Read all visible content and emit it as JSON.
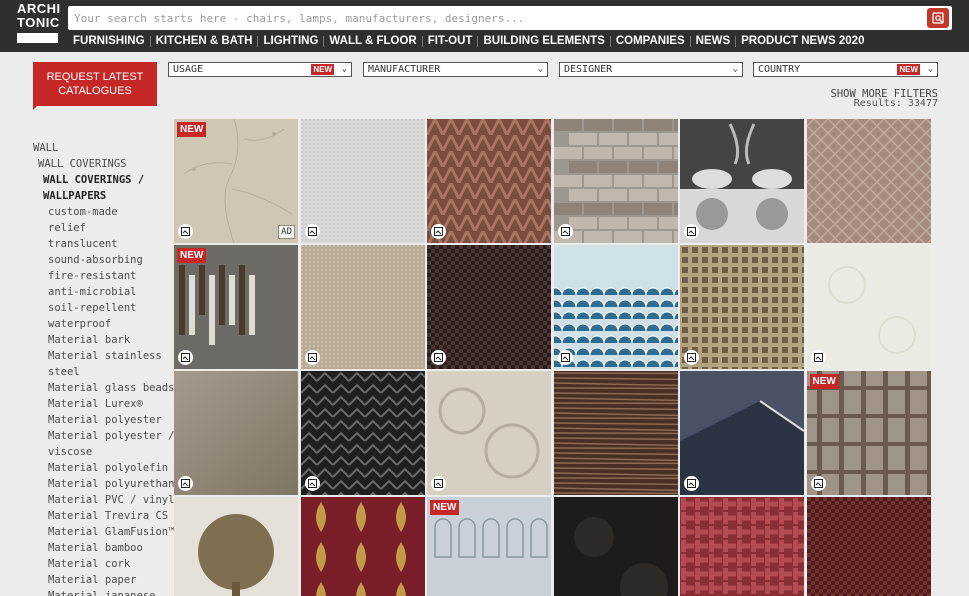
{
  "logo": {
    "line1": "ARCHI",
    "line2": "TONIC"
  },
  "search": {
    "placeholder": "Your search starts here - chairs, lamps, manufacturers, designers..."
  },
  "nav": [
    "FURNISHING",
    "KITCHEN & BATH",
    "LIGHTING",
    "WALL & FLOOR",
    "FIT-OUT",
    "BUILDING ELEMENTS",
    "COMPANIES",
    "NEWS",
    "PRODUCT NEWS 2020"
  ],
  "cta": {
    "line1": "REQUEST LATEST",
    "line2": "CATALOGUES"
  },
  "filters": [
    {
      "label": "USAGE",
      "new": "NEW"
    },
    {
      "label": "MANUFACTURER",
      "new": ""
    },
    {
      "label": "DESIGNER",
      "new": ""
    },
    {
      "label": "COUNTRY",
      "new": "NEW"
    }
  ],
  "more_filters": "SHOW MORE FILTERS",
  "results": "Results: 33477",
  "sidebar": {
    "l0": "WALL",
    "l1": "WALL COVERINGS",
    "l2a": "WALL COVERINGS /",
    "l2b": "WALLPAPERS",
    "items": [
      "custom-made",
      "relief",
      "translucent",
      "sound-absorbing",
      "fire-resistant",
      "anti-microbial",
      "soil-repellent",
      "waterproof",
      "Material bark",
      "Material stainless",
      "steel",
      "Material glass beads",
      "Material Lurex®",
      "Material polyester",
      "Material polyester /",
      "viscose",
      "Material polyolefin",
      "Material polyurethane",
      "Material PVC / vinyl",
      "Material Trevira CS",
      "Material GlamFusion™",
      "Material bamboo",
      "Material cork",
      "Material paper",
      "Material japanese"
    ]
  },
  "tiles": [
    {
      "new": "NEW",
      "ad": "AD",
      "save": true,
      "colors": [
        "#b8ad9c",
        "#cfc6b6"
      ],
      "pattern": "branch"
    },
    {
      "new": "",
      "ad": "",
      "save": true,
      "colors": [
        "#d9d9d9",
        "#c9c9c9"
      ],
      "pattern": "linen"
    },
    {
      "new": "",
      "ad": "",
      "save": true,
      "colors": [
        "#7a4e3e",
        "#a87463"
      ],
      "pattern": "herringbone"
    },
    {
      "new": "",
      "ad": "",
      "save": true,
      "colors": [
        "#9c9890",
        "#c9c1b4"
      ],
      "pattern": "planks"
    },
    {
      "new": "",
      "ad": "",
      "save": true,
      "colors": [
        "#2b2b2b",
        "#d8d8d8"
      ],
      "pattern": "figures"
    },
    {
      "new": "",
      "ad": "",
      "save": false,
      "colors": [
        "#a48a7f",
        "#c2aca1"
      ],
      "pattern": "diamond"
    },
    {
      "new": "NEW",
      "ad": "",
      "save": true,
      "colors": [
        "#6e6b66",
        "#9a958c"
      ],
      "pattern": "stripes"
    },
    {
      "new": "",
      "ad": "",
      "save": true,
      "colors": [
        "#b6aa97",
        "#cfc3b0"
      ],
      "pattern": "linen"
    },
    {
      "new": "",
      "ad": "",
      "save": true,
      "colors": [
        "#2a1f1c",
        "#4a3733"
      ],
      "pattern": "weave"
    },
    {
      "new": "",
      "ad": "",
      "save": true,
      "colors": [
        "#2f6b8f",
        "#cfe0e6"
      ],
      "pattern": "waves"
    },
    {
      "new": "",
      "ad": "",
      "save": true,
      "colors": [
        "#6d5e45",
        "#b3a47f"
      ],
      "pattern": "grid"
    },
    {
      "new": "",
      "ad": "",
      "save": true,
      "colors": [
        "#ecebe3",
        "#e0ddd0"
      ],
      "pattern": "damask"
    },
    {
      "new": "",
      "ad": "",
      "save": true,
      "colors": [
        "#7d7566",
        "#a69a8e"
      ],
      "pattern": "mist"
    },
    {
      "new": "",
      "ad": "",
      "save": true,
      "colors": [
        "#1f1f20",
        "#6a6a6c"
      ],
      "pattern": "chevron"
    },
    {
      "new": "",
      "ad": "",
      "save": true,
      "colors": [
        "#b5ae9e",
        "#d6d0c3"
      ],
      "pattern": "lace"
    },
    {
      "new": "",
      "ad": "",
      "save": false,
      "colors": [
        "#4a2f25",
        "#8c6a55"
      ],
      "pattern": "wood"
    },
    {
      "new": "",
      "ad": "",
      "save": true,
      "colors": [
        "#2c3444",
        "#4a5366"
      ],
      "pattern": "felt"
    },
    {
      "new": "NEW",
      "ad": "",
      "save": true,
      "colors": [
        "#6a5a4f",
        "#a09387"
      ],
      "pattern": "plaid"
    },
    {
      "new": "",
      "ad": "",
      "save": false,
      "colors": [
        "#6b5a3a",
        "#e6e1d8"
      ],
      "pattern": "tree"
    },
    {
      "new": "",
      "ad": "",
      "save": false,
      "colors": [
        "#7a1f2a",
        "#c29b4a"
      ],
      "pattern": "ornament"
    },
    {
      "new": "NEW",
      "ad": "",
      "save": false,
      "colors": [
        "#c9d1d6",
        "#8a98a1"
      ],
      "pattern": "arches"
    },
    {
      "new": "",
      "ad": "",
      "save": false,
      "colors": [
        "#1e1c1b",
        "#2e2a28"
      ],
      "pattern": "dark"
    },
    {
      "new": "",
      "ad": "",
      "save": false,
      "colors": [
        "#8a2d35",
        "#b24b52"
      ],
      "pattern": "basket"
    },
    {
      "new": "",
      "ad": "",
      "save": false,
      "colors": [
        "#4a1f1f",
        "#7a2e2a"
      ],
      "pattern": "weave"
    }
  ]
}
